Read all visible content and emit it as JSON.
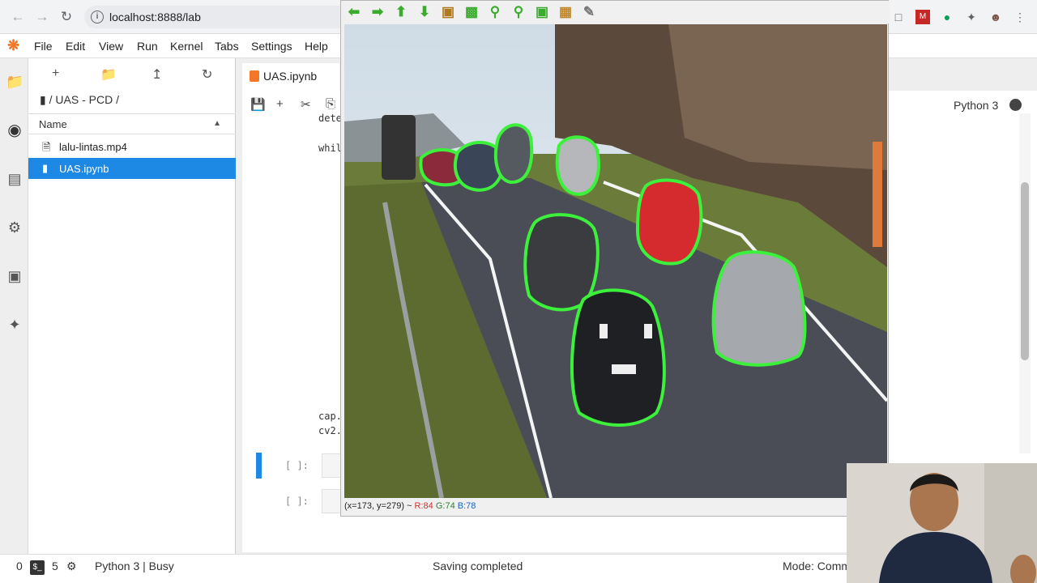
{
  "browser": {
    "url": "localhost:8888/lab",
    "back_icon": "arrow-left-icon",
    "forward_icon": "arrow-right-icon",
    "reload_icon": "reload-icon"
  },
  "menu": {
    "items": [
      "File",
      "Edit",
      "View",
      "Run",
      "Kernel",
      "Tabs",
      "Settings",
      "Help"
    ]
  },
  "file_browser": {
    "breadcrumb": "/ UAS - PCD /",
    "column_name": "Name",
    "files": [
      {
        "name": "lalu-lintas.mp4",
        "icon": "file-icon",
        "selected": false
      },
      {
        "name": "UAS.ipynb",
        "icon": "notebook-icon",
        "selected": true
      }
    ]
  },
  "notebook": {
    "tab_label": "UAS.ipynb",
    "kernel": "Python 3",
    "code_fragments": [
      "dete",
      "whil",
      "cap.",
      "cv2."
    ],
    "prompts": [
      "[ ]:",
      "[ ]:"
    ]
  },
  "cv_window": {
    "status_coords": "(x=173, y=279) ~",
    "status_r": "R:84",
    "status_g": "G:74",
    "status_b": "B:78",
    "status_colors": {
      "r": "#d32f2f",
      "g": "#2e7d32",
      "b": "#1565c0"
    }
  },
  "status_bar": {
    "count_left": "0",
    "count_terminals": "5",
    "kernel_status": "Python 3 | Busy",
    "message": "Saving completed",
    "mode": "Mode: Comm"
  },
  "colors": {
    "accent": "#1e88e5",
    "jupyter_orange": "#f37726",
    "contour_green": "#39e639"
  }
}
